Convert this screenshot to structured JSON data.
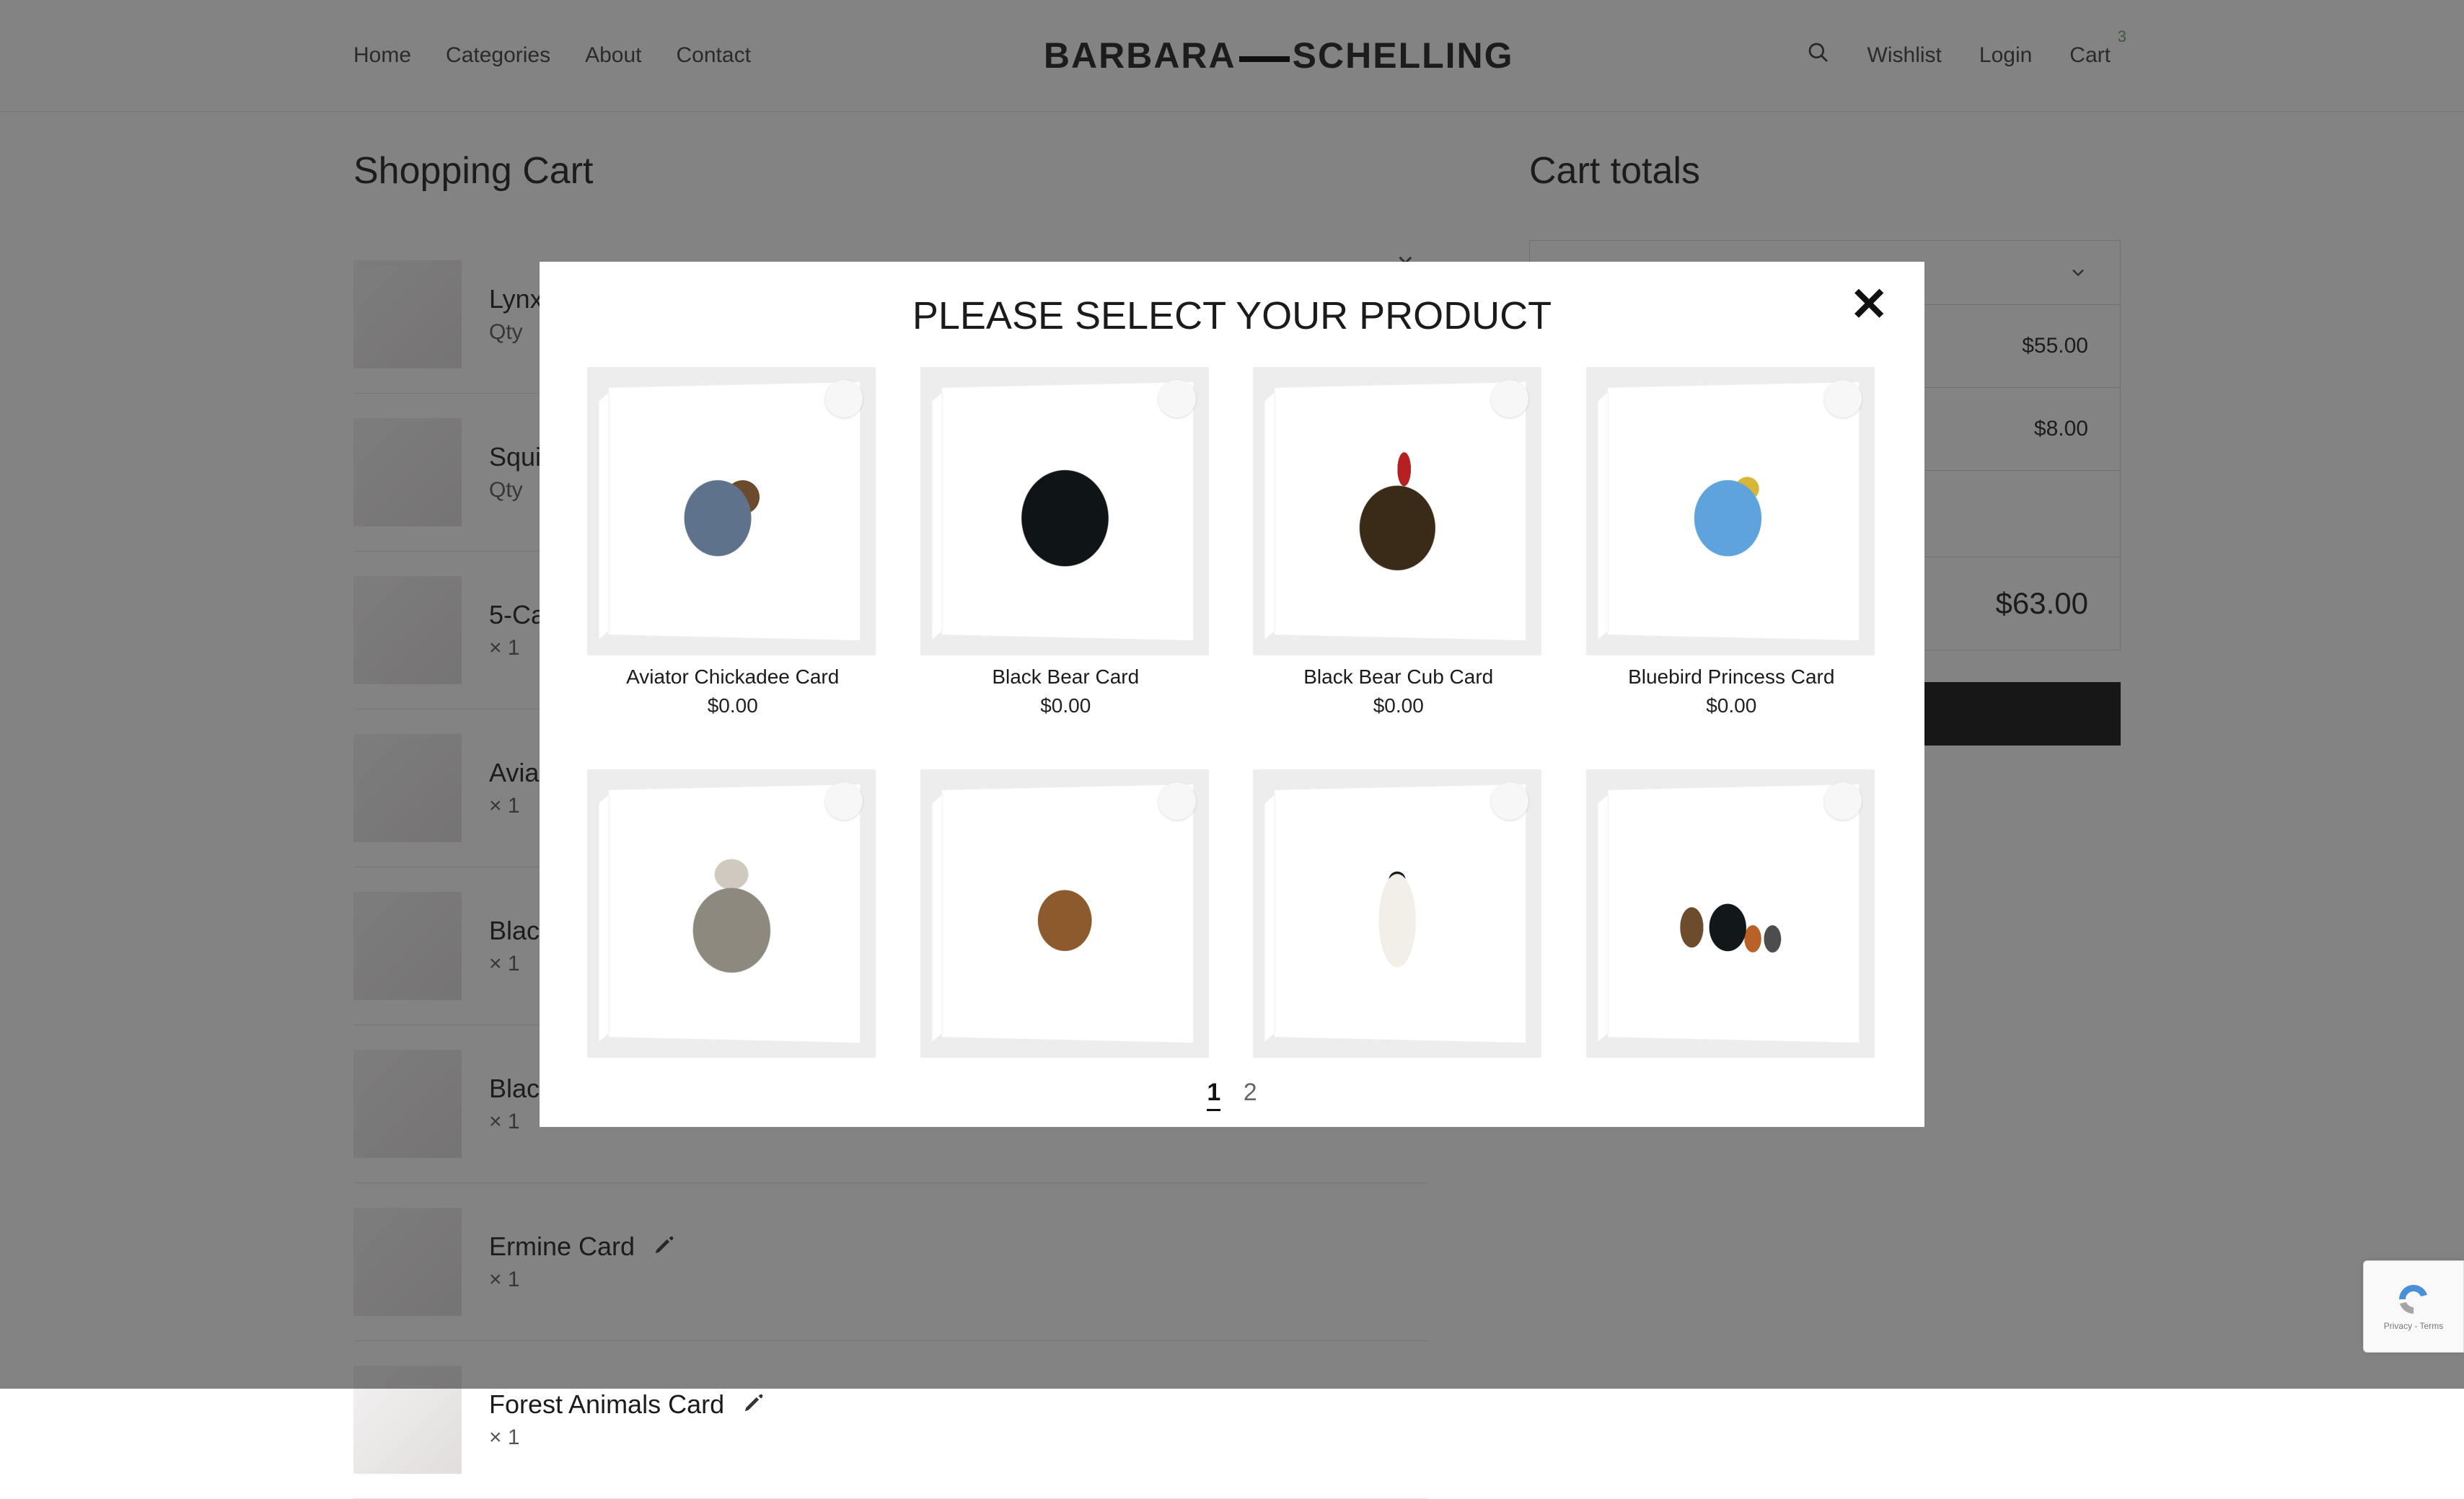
{
  "nav": {
    "home": "Home",
    "categories": "Categories",
    "about": "About",
    "contact": "Contact",
    "wishlist": "Wishlist",
    "login": "Login",
    "cart": "Cart",
    "cart_count": "3"
  },
  "logo": {
    "a": "BARBARA",
    "b": "SCHELLING"
  },
  "headings": {
    "cart": "Shopping Cart",
    "totals": "Cart totals"
  },
  "cart_items": [
    {
      "name": "Lynx",
      "qty_label": "Qty"
    },
    {
      "name": "Squi",
      "qty_label": "Qty"
    },
    {
      "name": "5-Ca",
      "qty_label": "× 1"
    },
    {
      "name": "Avia",
      "qty_label": "× 1"
    },
    {
      "name": "Blac",
      "qty_label": "× 1"
    },
    {
      "name": "Blac",
      "qty_label": "× 1"
    },
    {
      "name": "Ermine Card",
      "qty_label": "× 1"
    },
    {
      "name": "Forest Animals Card",
      "qty_label": "× 1"
    }
  ],
  "totals": {
    "row1_amount": "$55.00",
    "row2_amount": "$8.00",
    "grand_amount": "$63.00"
  },
  "checkout_label": "",
  "modal": {
    "title": "PLEASE SELECT YOUR PRODUCT",
    "products": [
      {
        "name": "Aviator Chickadee Card",
        "price": "$0.00",
        "art": "chickadee"
      },
      {
        "name": "Black Bear Card",
        "price": "$0.00",
        "art": "blackbear"
      },
      {
        "name": "Black Bear Cub Card",
        "price": "$0.00",
        "art": "bearcub"
      },
      {
        "name": "Bluebird Princess Card",
        "price": "$0.00",
        "art": "bluebird"
      },
      {
        "name": "",
        "price": "",
        "art": "raccoon"
      },
      {
        "name": "",
        "price": "",
        "art": "viking"
      },
      {
        "name": "",
        "price": "",
        "art": "ermine"
      },
      {
        "name": "",
        "price": "",
        "art": "forest"
      }
    ],
    "page_current": "1",
    "page_other": "2"
  },
  "recaptcha": {
    "line1": "reCAPTCHA",
    "line2": "Privacy - Terms"
  }
}
